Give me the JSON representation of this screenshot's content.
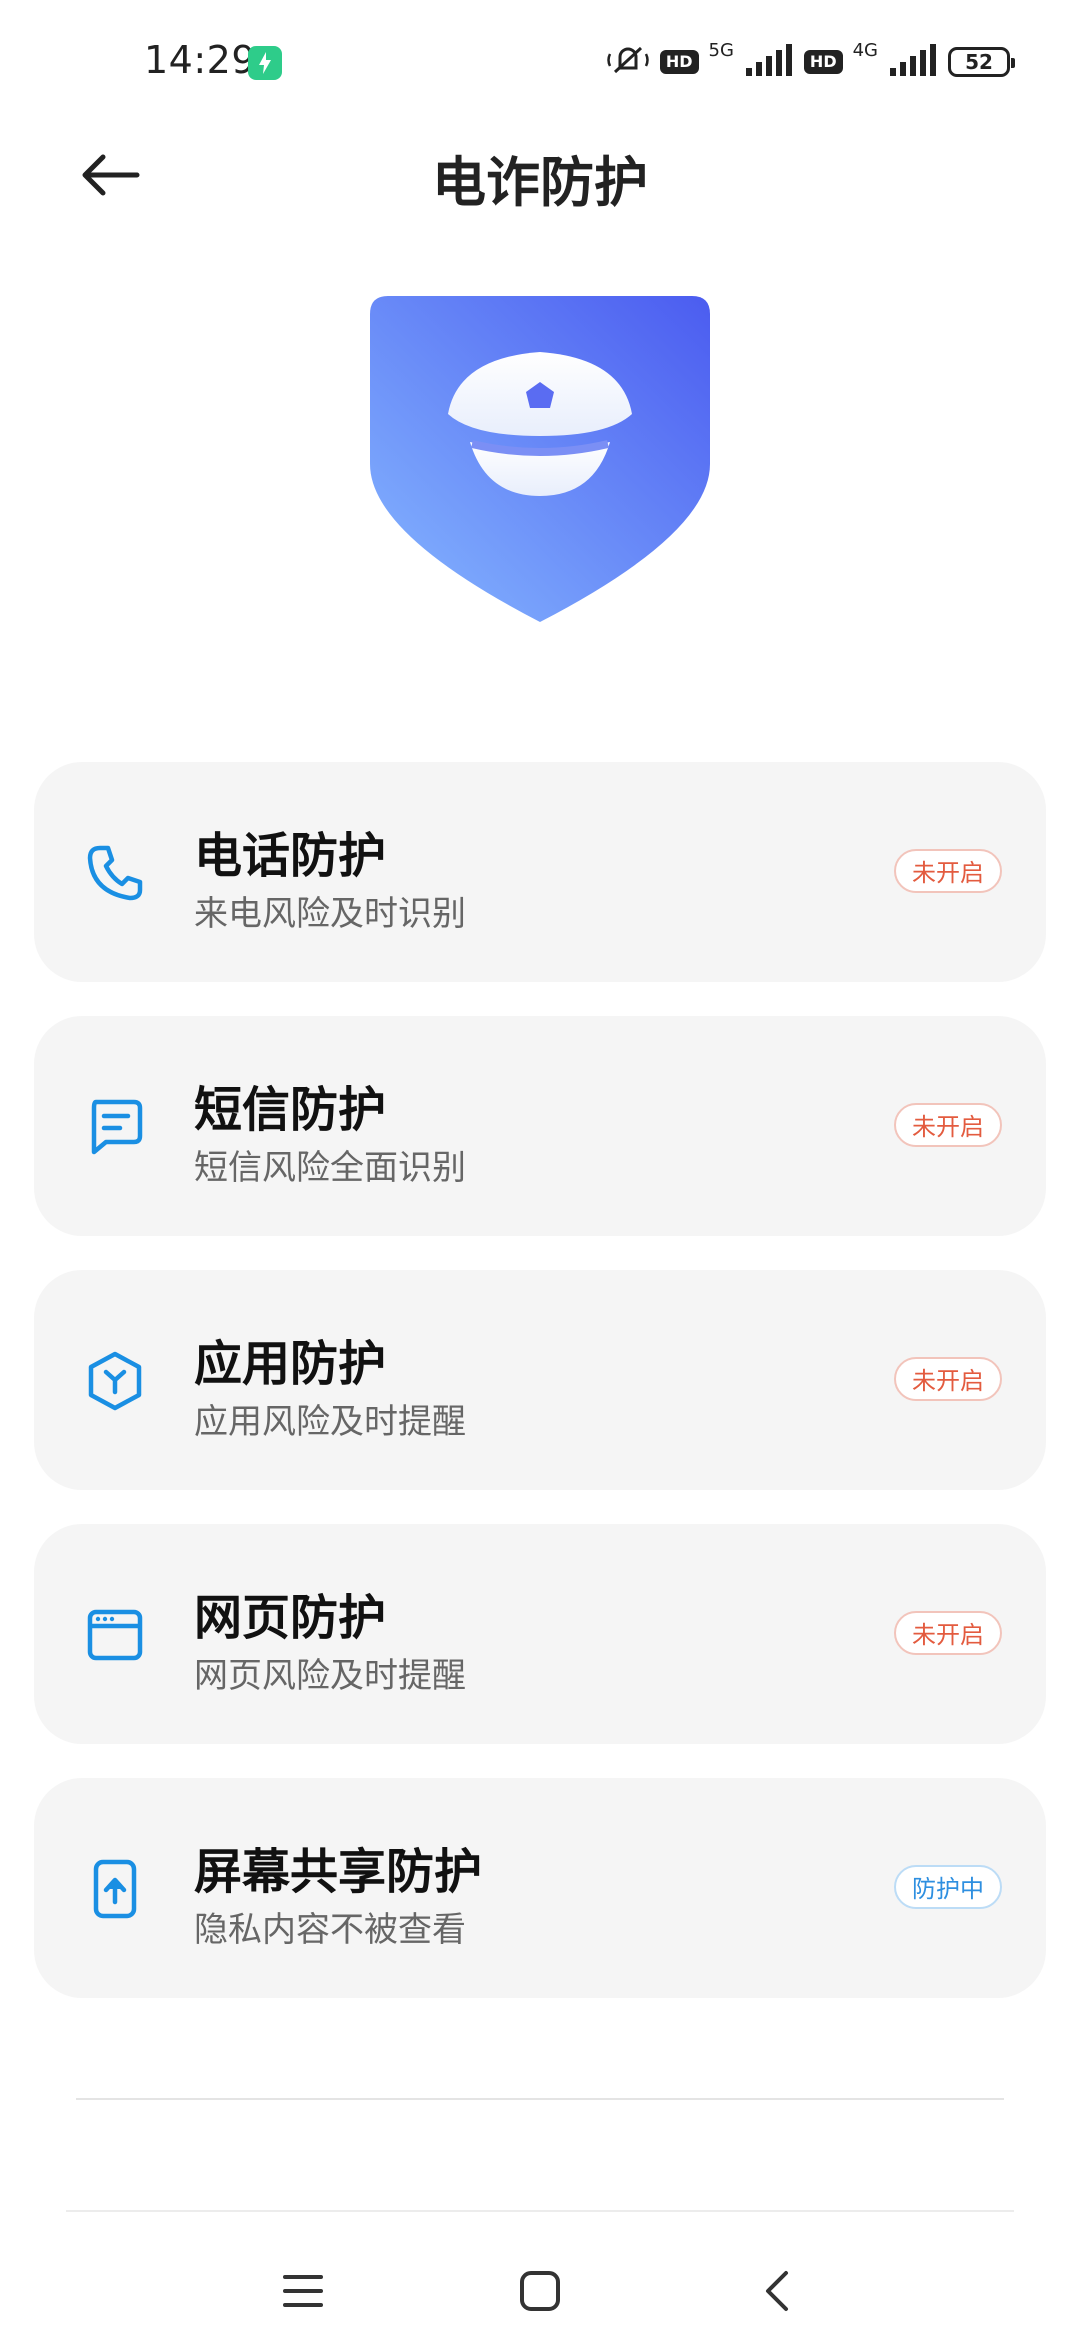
{
  "status_bar": {
    "time": "14:29",
    "net1": "5G",
    "net2": "4G",
    "hd": "HD",
    "battery": "52"
  },
  "header": {
    "title": "电诈防护"
  },
  "colors": {
    "accent_blue": "#1a8fe3",
    "status_off": "#e35b3f",
    "status_on": "#2e8fe0",
    "shield_top": "#4b5cf0",
    "shield_bottom": "#7fb0ff"
  },
  "items": [
    {
      "title": "电话防护",
      "subtitle": "来电风险及时识别",
      "status": "未开启",
      "icon": "phone-icon"
    },
    {
      "title": "短信防护",
      "subtitle": "短信风险全面识别",
      "status": "未开启",
      "icon": "message-icon"
    },
    {
      "title": "应用防护",
      "subtitle": "应用风险及时提醒",
      "status": "未开启",
      "icon": "app-cube-icon"
    },
    {
      "title": "网页防护",
      "subtitle": "网页风险及时提醒",
      "status": "未开启",
      "icon": "browser-icon"
    },
    {
      "title": "屏幕共享防护",
      "subtitle": "隐私内容不被查看",
      "status": "防护中",
      "icon": "screen-share-icon"
    }
  ]
}
